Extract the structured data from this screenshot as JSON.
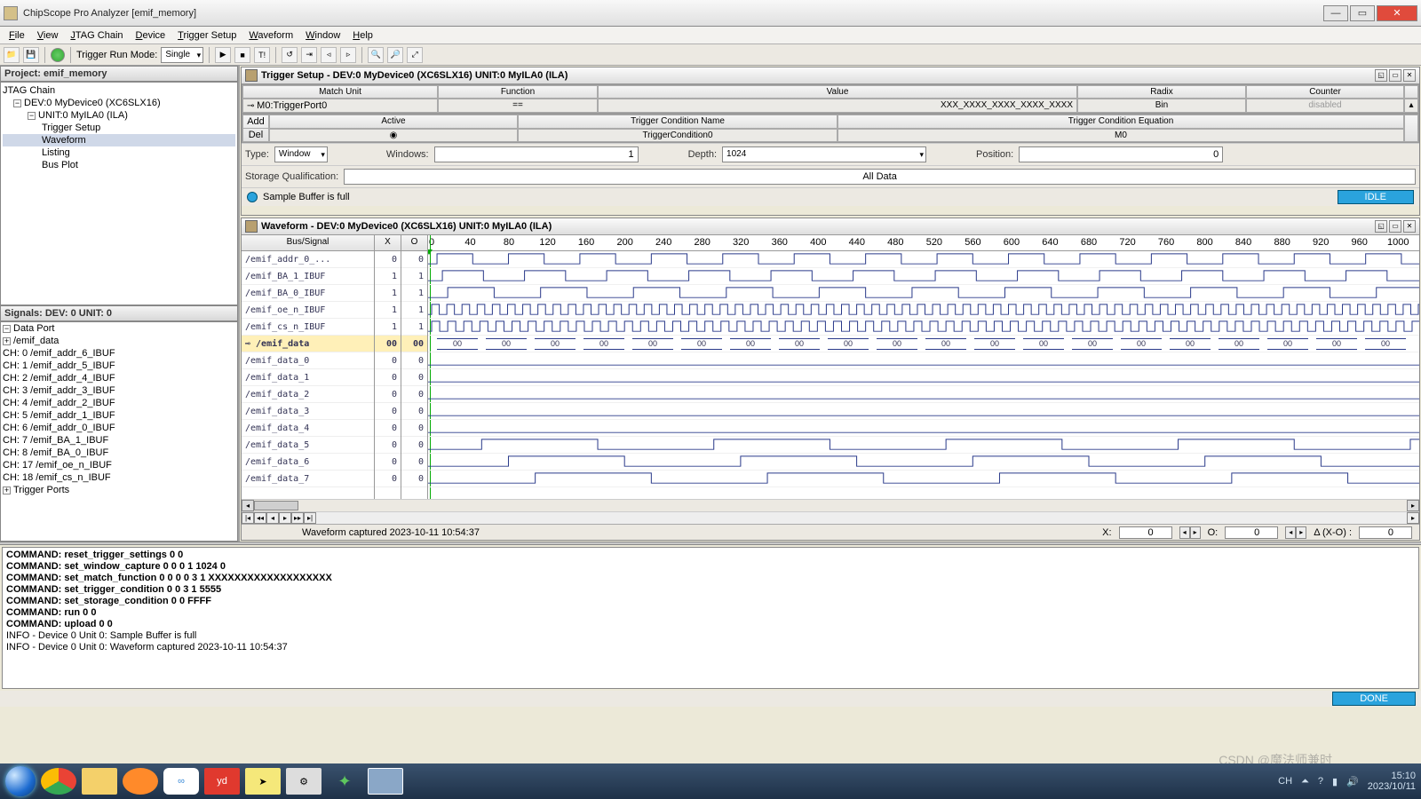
{
  "window": {
    "title": "ChipScope Pro Analyzer [emif_memory]"
  },
  "menu": [
    "File",
    "View",
    "JTAG Chain",
    "Device",
    "Trigger Setup",
    "Waveform",
    "Window",
    "Help"
  ],
  "toolbar": {
    "trigger_run_label": "Trigger Run Mode:",
    "trigger_run_value": "Single",
    "tbtn": "T!"
  },
  "project": {
    "header": "Project: emif_memory",
    "jtag_label": "JTAG Chain",
    "device": "DEV:0 MyDevice0 (XC6SLX16)",
    "unit": "UNIT:0 MyILA0 (ILA)",
    "children": [
      "Trigger Setup",
      "Waveform",
      "Listing",
      "Bus Plot"
    ],
    "selected": "Waveform"
  },
  "signals": {
    "header": "Signals: DEV: 0 UNIT: 0",
    "ports_a": "Data Port",
    "bus": "/emif_data",
    "channels": [
      "CH: 0 /emif_addr_6_IBUF",
      "CH: 1 /emif_addr_5_IBUF",
      "CH: 2 /emif_addr_4_IBUF",
      "CH: 3 /emif_addr_3_IBUF",
      "CH: 4 /emif_addr_2_IBUF",
      "CH: 5 /emif_addr_1_IBUF",
      "CH: 6 /emif_addr_0_IBUF",
      "CH: 7 /emif_BA_1_IBUF",
      "CH: 8 /emif_BA_0_IBUF",
      "CH: 17 /emif_oe_n_IBUF",
      "CH: 18 /emif_cs_n_IBUF"
    ],
    "ports_b": "Trigger Ports"
  },
  "trigger": {
    "title": "Trigger Setup - DEV:0 MyDevice0 (XC6SLX16) UNIT:0 MyILA0 (ILA)",
    "hdr1": [
      "Match Unit",
      "Function",
      "Value",
      "Radix",
      "Counter"
    ],
    "row1": [
      "M0:TriggerPort0",
      "==",
      "XXX_XXXX_XXXX_XXXX_XXXX",
      "Bin",
      "disabled"
    ],
    "add": "Add",
    "del": "Del",
    "hdr2": [
      "Active",
      "Trigger Condition Name",
      "Trigger Condition Equation"
    ],
    "row2": [
      "",
      "TriggerCondition0",
      "M0"
    ],
    "type_label": "Type:",
    "type_val": "Window",
    "windows_label": "Windows:",
    "windows_val": "1",
    "depth_label": "Depth:",
    "depth_val": "1024",
    "position_label": "Position:",
    "position_val": "0",
    "storage_label": "Storage Qualification:",
    "storage_val": "All Data",
    "sample_msg": "Sample Buffer is full",
    "idle": "IDLE"
  },
  "waveform": {
    "title": "Waveform - DEV:0 MyDevice0 (XC6SLX16) UNIT:0 MyILA0 (ILA)",
    "col_bus": "Bus/Signal",
    "col_x": "X",
    "col_o": "O",
    "ticks": [
      0,
      40,
      80,
      120,
      160,
      200,
      240,
      280,
      320,
      360,
      400,
      440,
      480,
      520,
      560,
      600,
      640,
      680,
      720,
      760,
      800,
      840,
      880,
      920,
      960,
      1000
    ],
    "rows": [
      {
        "name": "/emif_addr_0_...",
        "x": "0",
        "o": "0"
      },
      {
        "name": "/emif_BA_1_IBUF",
        "x": "1",
        "o": "1"
      },
      {
        "name": "/emif_BA_0_IBUF",
        "x": "1",
        "o": "1"
      },
      {
        "name": "/emif_oe_n_IBUF",
        "x": "1",
        "o": "1"
      },
      {
        "name": "/emif_cs_n_IBUF",
        "x": "1",
        "o": "1"
      },
      {
        "name": "/emif_data",
        "x": "00",
        "o": "00",
        "sel": true,
        "bus": true
      },
      {
        "name": "/emif_data_0",
        "x": "0",
        "o": "0"
      },
      {
        "name": "/emif_data_1",
        "x": "0",
        "o": "0"
      },
      {
        "name": "/emif_data_2",
        "x": "0",
        "o": "0"
      },
      {
        "name": "/emif_data_3",
        "x": "0",
        "o": "0"
      },
      {
        "name": "/emif_data_4",
        "x": "0",
        "o": "0"
      },
      {
        "name": "/emif_data_5",
        "x": "0",
        "o": "0"
      },
      {
        "name": "/emif_data_6",
        "x": "0",
        "o": "0"
      },
      {
        "name": "/emif_data_7",
        "x": "0",
        "o": "0"
      }
    ],
    "bus_val": "00",
    "captured": "Waveform captured 2023-10-11 10:54:37",
    "foot": {
      "X": "X:",
      "xval": "0",
      "O": "O:",
      "oval": "0",
      "delta": "Δ (X-O) :",
      "dval": "0"
    }
  },
  "log": [
    "COMMAND: reset_trigger_settings 0 0",
    "COMMAND: set_window_capture 0 0 0 1 1024 0",
    "COMMAND: set_match_function 0 0 0 0 3 1 XXXXXXXXXXXXXXXXXXX",
    "COMMAND: set_trigger_condition 0 0 3 1 5555",
    "COMMAND: set_storage_condition 0 0 FFFF",
    "COMMAND: run 0 0",
    "COMMAND: upload 0 0",
    "INFO - Device 0 Unit 0:  Sample Buffer is full",
    "INFO - Device 0 Unit 0: Waveform captured 2023-10-11 10:54:37"
  ],
  "done": "DONE",
  "tray": {
    "ch": "CH",
    "time": "15:10",
    "date": "2023/10/11"
  },
  "watermark": "CSDN @魔法师兼时"
}
